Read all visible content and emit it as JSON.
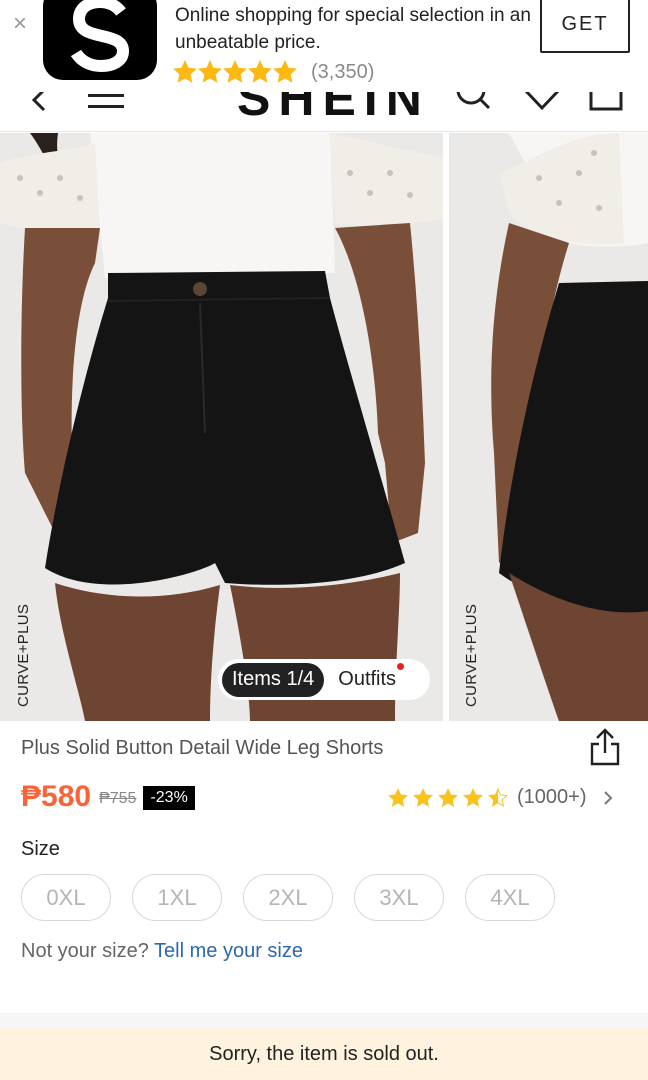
{
  "banner": {
    "close_glyph": "×",
    "app_icon": "shein-s-logo-icon",
    "description": "Online shopping for special selection in an unbeatable price.",
    "rating_count": "(3,350)",
    "star_rating": 5,
    "get_label": "GET",
    "star_color": "#fdb813"
  },
  "header": {
    "logo": "SHEIN",
    "icons": [
      "back-arrow-icon",
      "menu-icon",
      "search-icon",
      "wishlist-heart-icon",
      "cart-bag-icon"
    ]
  },
  "gallery": {
    "slides": [
      {
        "label": "CURVE+PLUS"
      },
      {
        "label": "CURVE+PLUS"
      }
    ],
    "pager": {
      "active_label": "Items 1/4",
      "outfits_label": "Outfits"
    }
  },
  "product": {
    "title": "Plus Solid Button Detail Wide Leg Shorts",
    "price": "₱580",
    "original_price": "₱755",
    "discount": "-23%",
    "rating_count": "(1000+)",
    "rating_stars": 4.5,
    "size_label": "Size",
    "sizes": [
      "0XL",
      "1XL",
      "2XL",
      "3XL",
      "4XL"
    ],
    "size_hint": "Not your size?",
    "size_hint_link": "Tell me your size",
    "accent_color": "#fa6338",
    "star_color": "#f8c31c"
  },
  "footer": {
    "sold_out_text": "Sorry, the item is sold out."
  }
}
